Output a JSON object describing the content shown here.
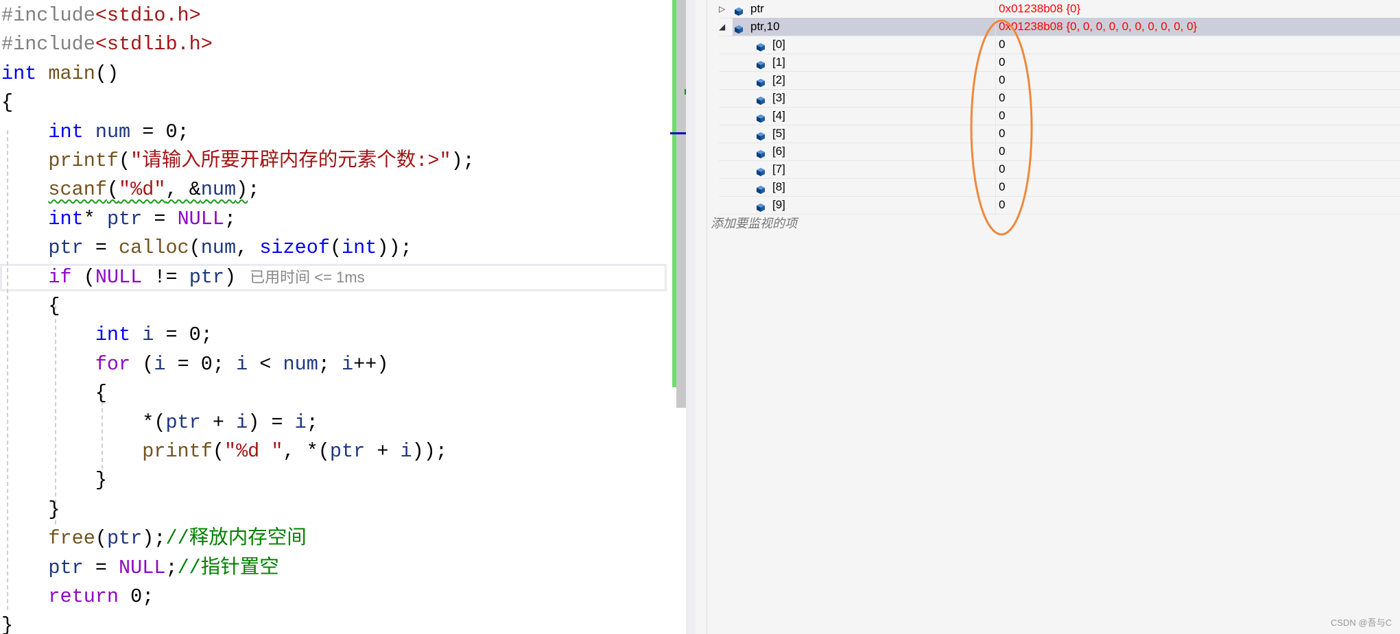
{
  "code": {
    "lines": [
      {
        "tokens": [
          {
            "t": "#include",
            "c": "pp"
          },
          {
            "t": "<stdio.h>",
            "c": "str"
          }
        ]
      },
      {
        "tokens": [
          {
            "t": "#include",
            "c": "pp"
          },
          {
            "t": "<stdlib.h>",
            "c": "str"
          }
        ]
      },
      {
        "tokens": [
          {
            "t": "int",
            "c": "kw"
          },
          {
            "t": " ",
            "c": "op"
          },
          {
            "t": "main",
            "c": "fn"
          },
          {
            "t": "()",
            "c": "op"
          }
        ]
      },
      {
        "tokens": [
          {
            "t": "{",
            "c": "op"
          }
        ]
      },
      {
        "tokens": [
          {
            "t": "    ",
            "c": "op"
          },
          {
            "t": "int",
            "c": "kw"
          },
          {
            "t": " num ",
            "c": "var"
          },
          {
            "t": "= 0;",
            "c": "op"
          }
        ]
      },
      {
        "tokens": [
          {
            "t": "    ",
            "c": "op"
          },
          {
            "t": "printf",
            "c": "fn"
          },
          {
            "t": "(",
            "c": "op"
          },
          {
            "t": "\"请输入所要开辟内存的元素个数:>\"",
            "c": "str"
          },
          {
            "t": ");",
            "c": "op"
          }
        ]
      },
      {
        "tokens": [
          {
            "t": "    ",
            "c": "op"
          },
          {
            "t": "scanf",
            "c": "fn squig"
          },
          {
            "t": "(",
            "c": "op squig"
          },
          {
            "t": "\"%d\"",
            "c": "str squig"
          },
          {
            "t": ", &",
            "c": "op squig"
          },
          {
            "t": "num",
            "c": "var squig"
          },
          {
            "t": ")",
            "c": "op squig"
          },
          {
            "t": ";",
            "c": "op"
          }
        ]
      },
      {
        "tokens": [
          {
            "t": "    ",
            "c": "op"
          },
          {
            "t": "int",
            "c": "kw"
          },
          {
            "t": "* ",
            "c": "op"
          },
          {
            "t": "ptr",
            "c": "var"
          },
          {
            "t": " = ",
            "c": "op"
          },
          {
            "t": "NULL",
            "c": "mac"
          },
          {
            "t": ";",
            "c": "op"
          }
        ]
      },
      {
        "tokens": [
          {
            "t": "    ",
            "c": "op"
          },
          {
            "t": "ptr",
            "c": "var"
          },
          {
            "t": " = ",
            "c": "op"
          },
          {
            "t": "calloc",
            "c": "fn"
          },
          {
            "t": "(",
            "c": "op"
          },
          {
            "t": "num",
            "c": "var"
          },
          {
            "t": ", ",
            "c": "op"
          },
          {
            "t": "sizeof",
            "c": "kw"
          },
          {
            "t": "(",
            "c": "op"
          },
          {
            "t": "int",
            "c": "kw"
          },
          {
            "t": "));",
            "c": "op"
          }
        ]
      },
      {
        "tokens": [
          {
            "t": "    ",
            "c": "op"
          },
          {
            "t": "if",
            "c": "ctl"
          },
          {
            "t": " (",
            "c": "op"
          },
          {
            "t": "NULL",
            "c": "mac"
          },
          {
            "t": " != ",
            "c": "op"
          },
          {
            "t": "ptr",
            "c": "var"
          },
          {
            "t": ")",
            "c": "op"
          }
        ],
        "hint": "已用时间 <= 1ms"
      },
      {
        "tokens": [
          {
            "t": "    ",
            "c": "op"
          },
          {
            "t": "{",
            "c": "op"
          }
        ]
      },
      {
        "tokens": [
          {
            "t": "        ",
            "c": "op"
          },
          {
            "t": "int",
            "c": "kw"
          },
          {
            "t": " i",
            "c": "var"
          },
          {
            "t": " = 0;",
            "c": "op"
          }
        ]
      },
      {
        "tokens": [
          {
            "t": "        ",
            "c": "op"
          },
          {
            "t": "for",
            "c": "ctl"
          },
          {
            "t": " (",
            "c": "op"
          },
          {
            "t": "i",
            "c": "var"
          },
          {
            "t": " = 0; ",
            "c": "op"
          },
          {
            "t": "i",
            "c": "var"
          },
          {
            "t": " < ",
            "c": "op"
          },
          {
            "t": "num",
            "c": "var"
          },
          {
            "t": "; ",
            "c": "op"
          },
          {
            "t": "i",
            "c": "var"
          },
          {
            "t": "++)",
            "c": "op"
          }
        ]
      },
      {
        "tokens": [
          {
            "t": "        ",
            "c": "op"
          },
          {
            "t": "{",
            "c": "op"
          }
        ]
      },
      {
        "tokens": [
          {
            "t": "            ",
            "c": "op"
          },
          {
            "t": "*(",
            "c": "op"
          },
          {
            "t": "ptr",
            "c": "var"
          },
          {
            "t": " + ",
            "c": "op"
          },
          {
            "t": "i",
            "c": "var"
          },
          {
            "t": ") = ",
            "c": "op"
          },
          {
            "t": "i",
            "c": "var"
          },
          {
            "t": ";",
            "c": "op"
          }
        ]
      },
      {
        "tokens": [
          {
            "t": "            ",
            "c": "op"
          },
          {
            "t": "printf",
            "c": "fn"
          },
          {
            "t": "(",
            "c": "op"
          },
          {
            "t": "\"%d \"",
            "c": "str"
          },
          {
            "t": ", *(",
            "c": "op"
          },
          {
            "t": "ptr",
            "c": "var"
          },
          {
            "t": " + ",
            "c": "op"
          },
          {
            "t": "i",
            "c": "var"
          },
          {
            "t": "));",
            "c": "op"
          }
        ]
      },
      {
        "tokens": [
          {
            "t": "        ",
            "c": "op"
          },
          {
            "t": "}",
            "c": "op"
          }
        ]
      },
      {
        "tokens": [
          {
            "t": "    ",
            "c": "op"
          },
          {
            "t": "}",
            "c": "op"
          }
        ]
      },
      {
        "tokens": [
          {
            "t": "    ",
            "c": "op"
          },
          {
            "t": "free",
            "c": "fn"
          },
          {
            "t": "(",
            "c": "op"
          },
          {
            "t": "ptr",
            "c": "var"
          },
          {
            "t": ");",
            "c": "op"
          },
          {
            "t": "//释放内存空间",
            "c": "cmt"
          }
        ]
      },
      {
        "tokens": [
          {
            "t": "    ",
            "c": "op"
          },
          {
            "t": "ptr",
            "c": "var"
          },
          {
            "t": " = ",
            "c": "op"
          },
          {
            "t": "NULL",
            "c": "mac"
          },
          {
            "t": ";",
            "c": "op"
          },
          {
            "t": "//指针置空",
            "c": "cmt"
          }
        ]
      },
      {
        "tokens": [
          {
            "t": "    ",
            "c": "op"
          },
          {
            "t": "return",
            "c": "ctl"
          },
          {
            "t": " 0;",
            "c": "op"
          }
        ]
      },
      {
        "tokens": [
          {
            "t": "}",
            "c": "op"
          }
        ]
      }
    ]
  },
  "watch": {
    "rows": [
      {
        "name": "ptr",
        "value": "0x01238b08 {0}",
        "expander": "collapsed",
        "level": 0,
        "selected": false,
        "value_color": "#ff0000"
      },
      {
        "name": "ptr,10",
        "value": "0x01238b08 {0, 0, 0, 0, 0, 0, 0, 0, 0, 0}",
        "expander": "expanded",
        "level": 0,
        "selected": true,
        "value_color": "#ff0000"
      },
      {
        "name": "[0]",
        "value": "0",
        "level": 1
      },
      {
        "name": "[1]",
        "value": "0",
        "level": 1
      },
      {
        "name": "[2]",
        "value": "0",
        "level": 1
      },
      {
        "name": "[3]",
        "value": "0",
        "level": 1
      },
      {
        "name": "[4]",
        "value": "0",
        "level": 1
      },
      {
        "name": "[5]",
        "value": "0",
        "level": 1
      },
      {
        "name": "[6]",
        "value": "0",
        "level": 1
      },
      {
        "name": "[7]",
        "value": "0",
        "level": 1
      },
      {
        "name": "[8]",
        "value": "0",
        "level": 1
      },
      {
        "name": "[9]",
        "value": "0",
        "level": 1
      }
    ],
    "add_placeholder": "添加要监视的项",
    "item_icon": "variable-cube-icon",
    "annotation_color": "#f0883a"
  },
  "watermark": "CSDN @吾与C"
}
